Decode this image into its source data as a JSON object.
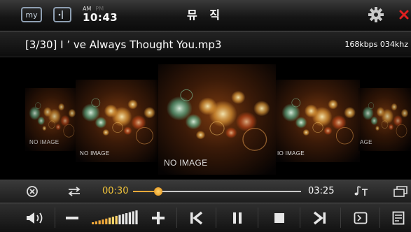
{
  "header": {
    "title": "뮤 직",
    "my_label": "my",
    "clock": {
      "am": "AM",
      "pm": "PM",
      "time": "10:43"
    },
    "icons": {
      "my": "my-icon",
      "split": "split-screen-icon",
      "settings": "gear-icon",
      "close": "close-icon"
    },
    "close_color": "#e02020"
  },
  "now_playing": {
    "track": "[3/30] I ’ ve Always Thought You.mp3",
    "bitrate": "168kbps 034khz"
  },
  "coverflow": {
    "covers": [
      {
        "label": "NO IMAGE"
      },
      {
        "label": "NO IMAGE"
      },
      {
        "label": "NO IMAGE"
      },
      {
        "label": "IO IMAGE"
      },
      {
        "label": "AGE"
      }
    ]
  },
  "seek": {
    "current": "00:30",
    "total": "03:25",
    "progress": 0.15,
    "accent": "#f2c43a"
  },
  "controls": {
    "volume_level": 0.6,
    "icons": [
      "speaker-icon",
      "volume-down-icon",
      "volume-level-icon",
      "volume-up-icon",
      "previous-icon",
      "pause-icon",
      "stop-icon",
      "next-icon",
      "screen-icon",
      "list-icon"
    ]
  },
  "seek_icons": [
    "shuffle-off-icon",
    "repeat-icon",
    "lyrics-icon",
    "playlist-icon"
  ]
}
